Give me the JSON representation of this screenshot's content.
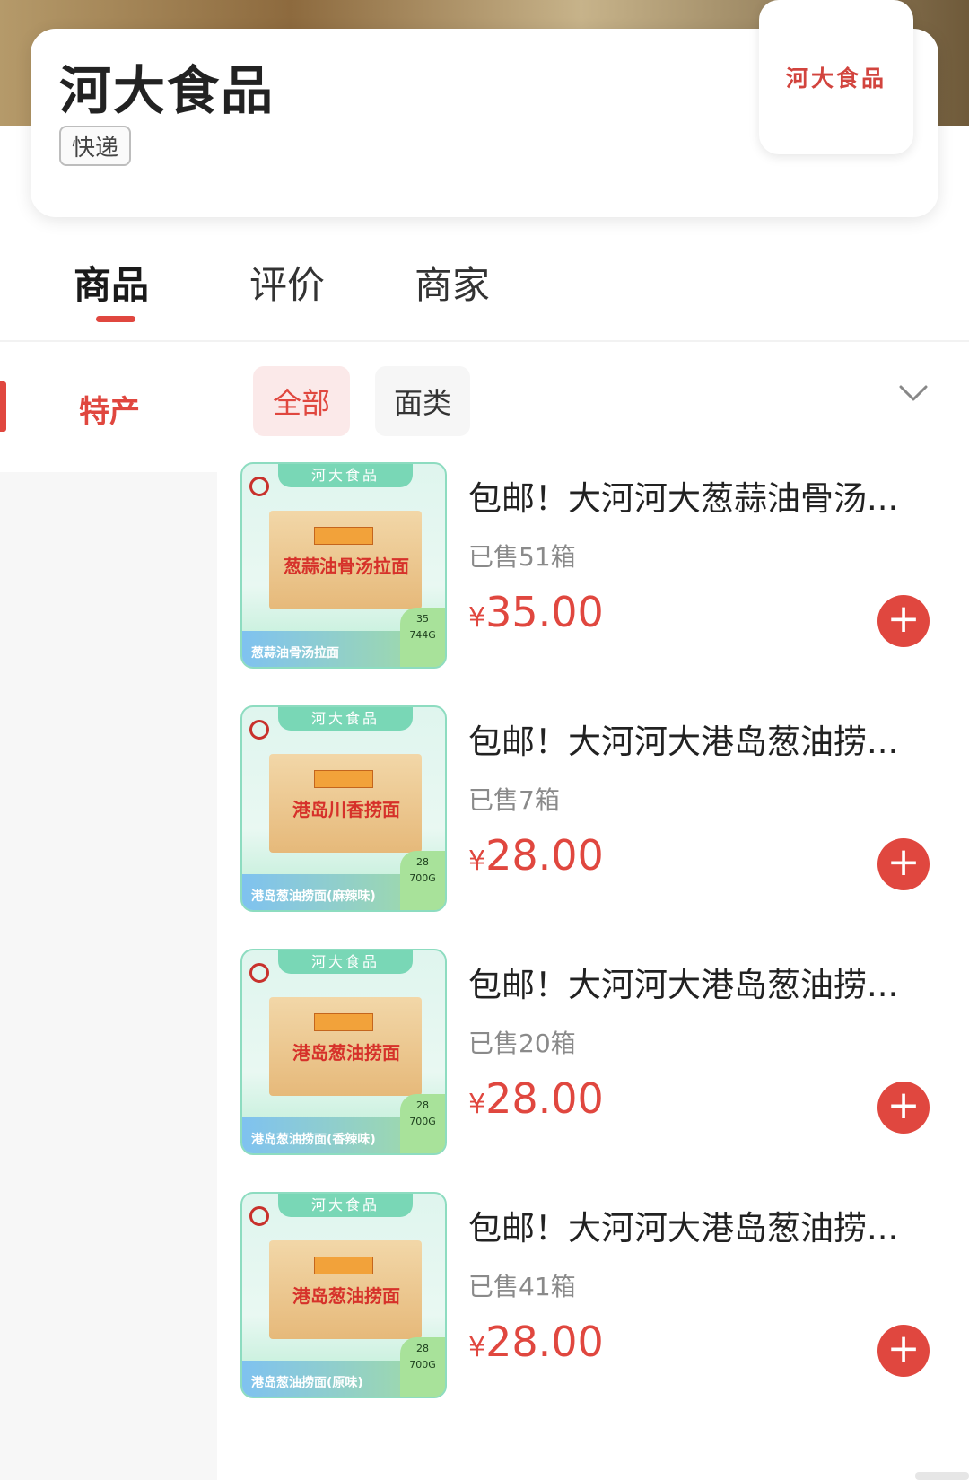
{
  "shop": {
    "name": "河大食品",
    "tag": "快递",
    "logo_text": "河大食品"
  },
  "tabs": [
    {
      "label": "商品",
      "active": true
    },
    {
      "label": "评价",
      "active": false
    },
    {
      "label": "商家",
      "active": false
    }
  ],
  "sidebar": {
    "items": [
      {
        "label": "特产",
        "active": true
      }
    ]
  },
  "filters": {
    "chips": [
      {
        "label": "全部",
        "active": true
      },
      {
        "label": "面类",
        "active": false
      }
    ],
    "expand_icon": "chevron-down-icon"
  },
  "products": [
    {
      "title": "包邮！大河河大葱蒜油骨汤...",
      "sold": "已售51箱",
      "currency": "¥",
      "price": "35.00",
      "thumb": {
        "brand": "河大食品",
        "box_title": "葱蒜油骨汤拉面",
        "band": "葱蒜油骨汤拉面",
        "corner_price": "35",
        "weight": "744G"
      }
    },
    {
      "title": "包邮！大河河大港岛葱油捞...",
      "sold": "已售7箱",
      "currency": "¥",
      "price": "28.00",
      "thumb": {
        "brand": "河大食品",
        "box_title": "港岛川香捞面",
        "band": "港岛葱油捞面(麻辣味)",
        "corner_price": "28",
        "weight": "700G"
      }
    },
    {
      "title": "包邮！大河河大港岛葱油捞...",
      "sold": "已售20箱",
      "currency": "¥",
      "price": "28.00",
      "thumb": {
        "brand": "河大食品",
        "box_title": "港岛葱油捞面",
        "band": "港岛葱油捞面(香辣味)",
        "corner_price": "28",
        "weight": "700G"
      }
    },
    {
      "title": "包邮！大河河大港岛葱油捞...",
      "sold": "已售41箱",
      "currency": "¥",
      "price": "28.00",
      "thumb": {
        "brand": "河大食品",
        "box_title": "港岛葱油捞面",
        "band": "港岛葱油捞面(原味)",
        "corner_price": "28",
        "weight": "700G"
      }
    }
  ],
  "colors": {
    "accent": "#e0473f",
    "chip_active_bg": "#fbe9e9",
    "sidebar_bg": "#f7f7f7"
  }
}
